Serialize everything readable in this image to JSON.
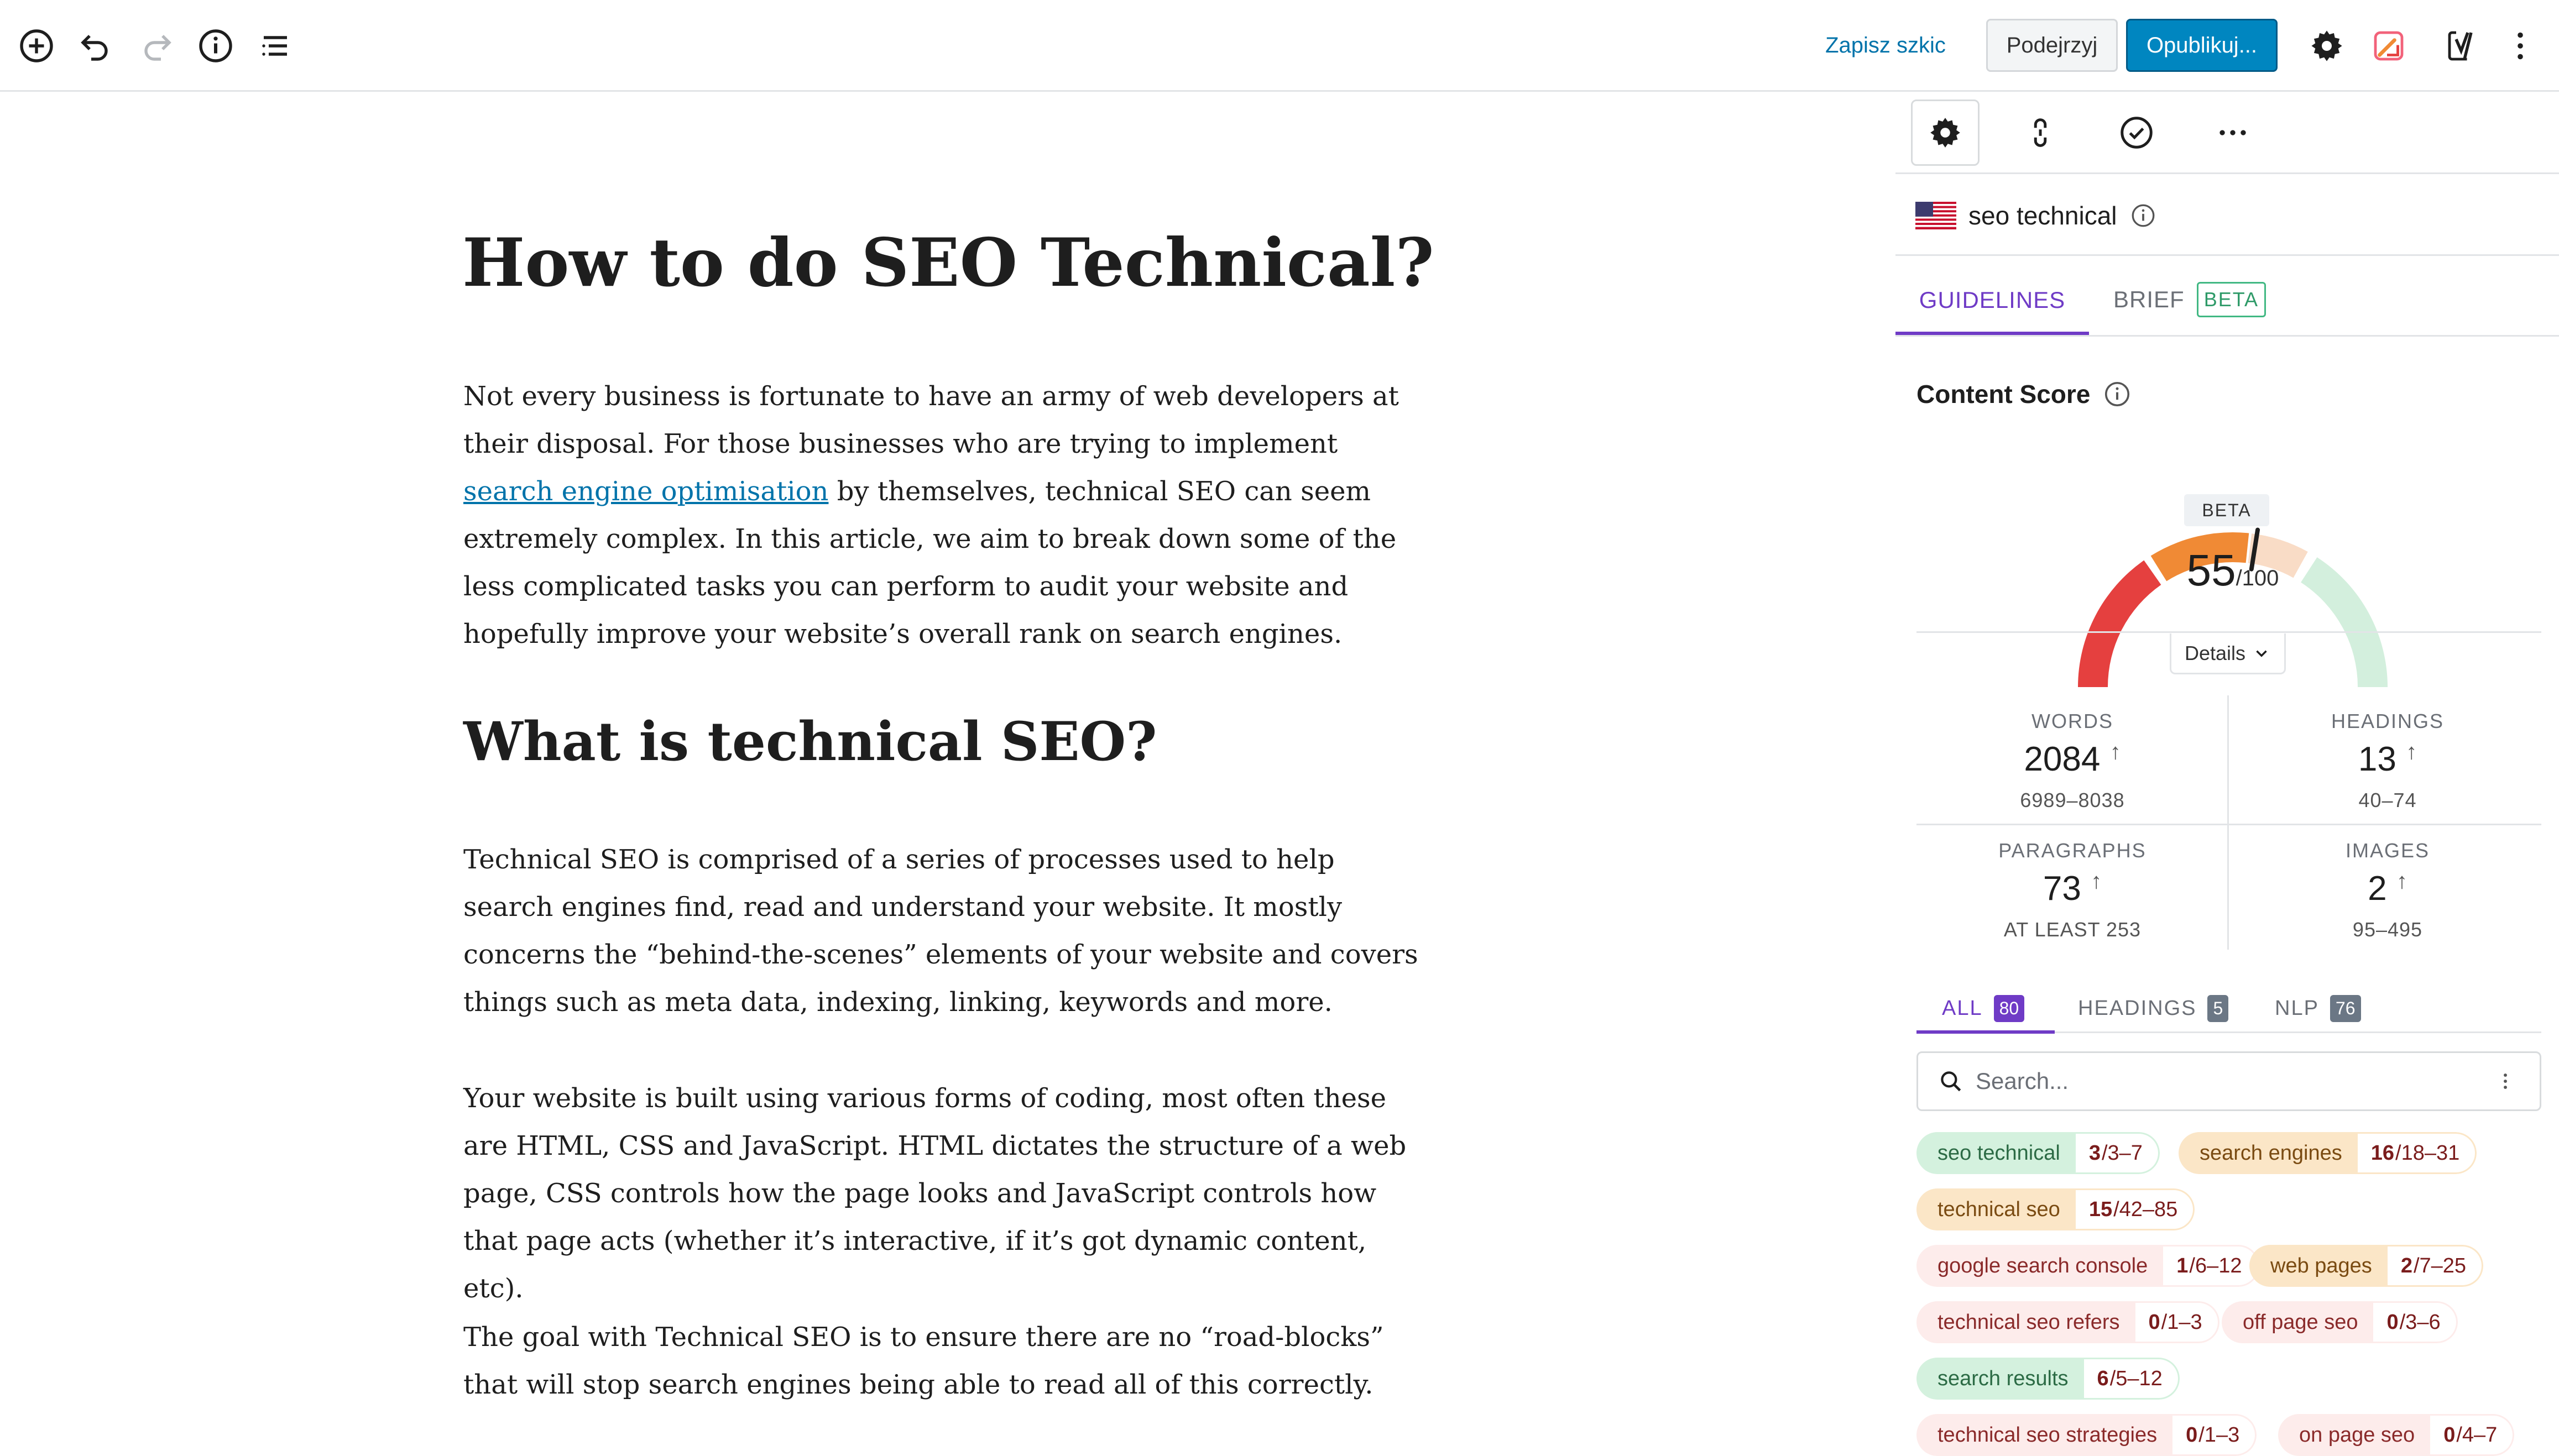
{
  "toolbar": {
    "save_draft": "Zapisz szkic",
    "preview": "Podejrzyj",
    "publish": "Opublikuj..."
  },
  "post": {
    "title": "How to do SEO Technical?",
    "p1_before": "Not every business is fortunate to have an army of web developers at their disposal. For those businesses who are trying to implement ",
    "p1_link": "search engine optimisation",
    "p1_after": " by themselves, technical SEO can seem extremely complex. In this article, we aim to break down some of the less complicated tasks you can perform to audit your website and hopefully improve your website’s overall rank on search engines.",
    "h2": "What is technical SEO?",
    "p2": "Technical SEO is comprised of a series of processes used to help search engines find, read and understand your website. It mostly concerns the “behind-the-scenes” elements of your website and covers things such as meta data, indexing, linking, keywords and more.",
    "p3": "Your website is built using various forms of coding, most often these are HTML, CSS and JavaScript. HTML dictates the structure of a web page, CSS controls how the page looks and JavaScript controls how that page acts (whether it’s interactive, if it’s got dynamic content, etc).",
    "p4": "The goal with Technical SEO is to ensure there are no “road-blocks” that will stop search engines being able to read all of this correctly."
  },
  "sidebar": {
    "keyword": "seo technical",
    "tabs": {
      "guidelines": "GUIDELINES",
      "brief": "BRIEF",
      "beta": "BETA"
    },
    "content_score_title": "Content Score",
    "gauge": {
      "badge": "BETA",
      "score": "55",
      "max": "/100",
      "score_value": 55
    },
    "details": "Details",
    "stats": {
      "words": {
        "label": "WORDS",
        "value": "2084",
        "range": "6989–8038"
      },
      "headings": {
        "label": "HEADINGS",
        "value": "13",
        "range": "40–74"
      },
      "paragraphs": {
        "label": "PARAGRAPHS",
        "value": "73",
        "range": "AT LEAST 253"
      },
      "images": {
        "label": "IMAGES",
        "value": "2",
        "range": "95–495"
      }
    },
    "filter_tabs": {
      "all": {
        "label": "ALL",
        "count": "80"
      },
      "headings": {
        "label": "HEADINGS",
        "count": "5"
      },
      "nlp": {
        "label": "NLP",
        "count": "76"
      }
    },
    "search_placeholder": "Search...",
    "terms": [
      {
        "term": "seo technical",
        "used": "3",
        "range": "/3–7",
        "status": "green"
      },
      {
        "term": "search engines",
        "used": "16",
        "range": "/18–31",
        "status": "orange"
      },
      {
        "term": "technical seo",
        "used": "15",
        "range": "/42–85",
        "status": "orange"
      },
      {
        "term": "google search console",
        "used": "1",
        "range": "/6–12",
        "status": "red"
      },
      {
        "term": "web pages",
        "used": "2",
        "range": "/7–25",
        "status": "orange"
      },
      {
        "term": "technical seo refers",
        "used": "0",
        "range": "/1–3",
        "status": "red"
      },
      {
        "term": "off page seo",
        "used": "0",
        "range": "/3–6",
        "status": "red"
      },
      {
        "term": "search results",
        "used": "6",
        "range": "/5–12",
        "status": "green"
      },
      {
        "term": "technical seo strategies",
        "used": "0",
        "range": "/1–3",
        "status": "red"
      },
      {
        "term": "on page seo",
        "used": "0",
        "range": "/4–7",
        "status": "red"
      }
    ]
  },
  "colors": {
    "accent_purple": "#6f3bc6",
    "wp_blue": "#0086c0",
    "gauge_red": "#e5403f",
    "gauge_orange": "#f08a35",
    "gauge_peach": "#f9dcc6",
    "gauge_green": "#d3efdd"
  }
}
